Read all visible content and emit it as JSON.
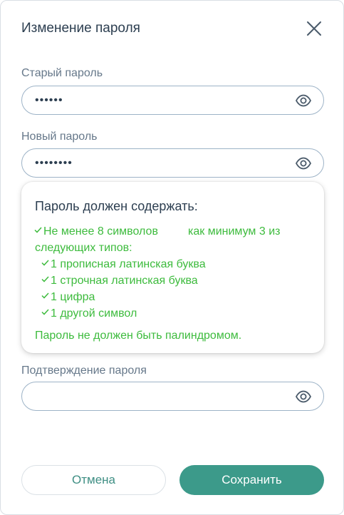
{
  "dialog": {
    "title": "Изменение пароля"
  },
  "old_password": {
    "label": "Старый пароль",
    "value": "••••••"
  },
  "new_password": {
    "label": "Новый пароль",
    "value": "••••••••"
  },
  "rules": {
    "title": "Пароль должен содержать:",
    "min_chars": "Не менее 8 символов",
    "at_least_3_line1": "как минимум 3 из",
    "at_least_3_line2": "следующих типов:",
    "uppercase": "1 прописная латинская буква",
    "lowercase": "1 строчная латинская буква",
    "digit": "1 цифра",
    "special": "1 другой символ",
    "palindrome": "Пароль не должен быть палиндромом.",
    "ok_color": "#3dbb3d"
  },
  "confirm_password": {
    "label": "Подтверждение пароля",
    "value": ""
  },
  "actions": {
    "cancel_label": "Отмена",
    "save_label": "Сохранить"
  },
  "colors": {
    "accent": "#3c9a8a",
    "field_border": "#9db3c7"
  }
}
